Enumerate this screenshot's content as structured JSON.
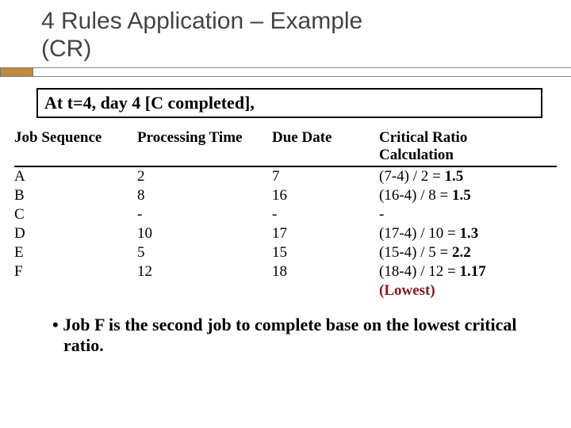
{
  "title_line1": "4 Rules Application – Example",
  "title_line2": "(CR)",
  "context": "At t=4, day 4 [C completed],",
  "headers": {
    "c1": "Job Sequence",
    "c2": "Processing Time",
    "c3": "Due Date",
    "c4a": "Critical Ratio",
    "c4b": "Calculation"
  },
  "rows": [
    {
      "job": "A",
      "pt": "2",
      "dd": "7",
      "cr_expr": "(7-4) / 2 = ",
      "cr_val": "1.5",
      "lowest": false
    },
    {
      "job": "B",
      "pt": "8",
      "dd": "16",
      "cr_expr": "(16-4) / 8 = ",
      "cr_val": "1.5",
      "lowest": false
    },
    {
      "job": "C",
      "pt": "-",
      "dd": "-",
      "cr_expr": "-",
      "cr_val": "",
      "lowest": false
    },
    {
      "job": "D",
      "pt": "10",
      "dd": "17",
      "cr_expr": "(17-4) / 10 = ",
      "cr_val": "1.3",
      "lowest": false
    },
    {
      "job": "E",
      "pt": "5",
      "dd": "15",
      "cr_expr": "(15-4) / 5 = ",
      "cr_val": "2.2",
      "lowest": false
    },
    {
      "job": "F",
      "pt": "12",
      "dd": "18",
      "cr_expr": "(18-4) / 12 = ",
      "cr_val": "1.17",
      "lowest": true
    }
  ],
  "lowest_tag": "(Lowest)",
  "conclusion": "Job F is the second job to complete base on the lowest critical ratio.",
  "chart_data": {
    "type": "table",
    "title": "Critical Ratio at t=4",
    "columns": [
      "Job Sequence",
      "Processing Time",
      "Due Date",
      "Critical Ratio"
    ],
    "rows": [
      [
        "A",
        2,
        7,
        1.5
      ],
      [
        "B",
        8,
        16,
        1.5
      ],
      [
        "C",
        null,
        null,
        null
      ],
      [
        "D",
        10,
        17,
        1.3
      ],
      [
        "E",
        5,
        15,
        2.2
      ],
      [
        "F",
        12,
        18,
        1.17
      ]
    ]
  }
}
